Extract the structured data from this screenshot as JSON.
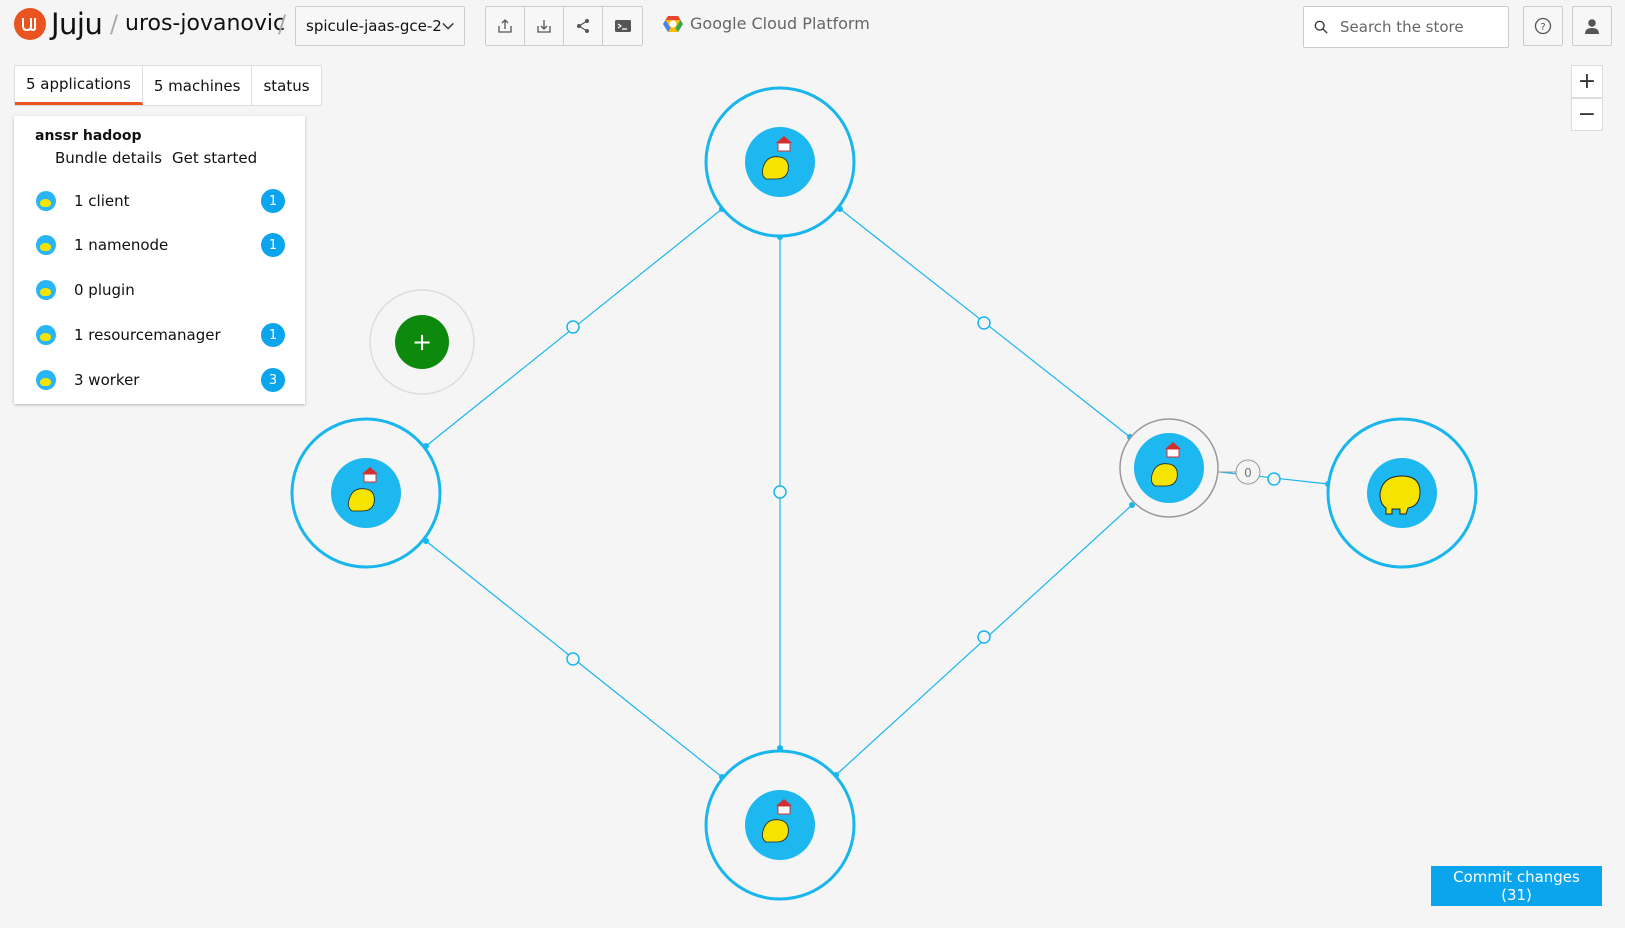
{
  "header": {
    "logo_text": "Juju",
    "user": "uros-jovanovic",
    "model_name": "spicule-jaas-gce-2",
    "cloud_label": "Google Cloud Platform",
    "search_placeholder": "Search the store",
    "toolbar_icons": [
      "export-icon",
      "import-icon",
      "share-icon",
      "terminal-icon"
    ]
  },
  "tabs": [
    {
      "label": "5 applications",
      "active": true
    },
    {
      "label": "5 machines",
      "active": false
    },
    {
      "label": "status",
      "active": false
    }
  ],
  "bundle": {
    "name": "anssr hadoop",
    "links": [
      "Bundle details",
      "Get started"
    ]
  },
  "applications": [
    {
      "label": "1 client",
      "count": "1"
    },
    {
      "label": "1 namenode",
      "count": "1"
    },
    {
      "label": "0 plugin",
      "count": ""
    },
    {
      "label": "1 resourcemanager",
      "count": "1"
    },
    {
      "label": "3 worker",
      "count": "3"
    }
  ],
  "canvas": {
    "relation_badge": "0",
    "add_symbol": "+",
    "zoom_in": "+",
    "zoom_out": "−"
  },
  "commit_label": "Commit changes (31)",
  "colors": {
    "accent": "#e95420",
    "link_blue": "#0ba5ee",
    "add_green": "#0d8a0d",
    "elephant_yellow": "#f5e400"
  }
}
